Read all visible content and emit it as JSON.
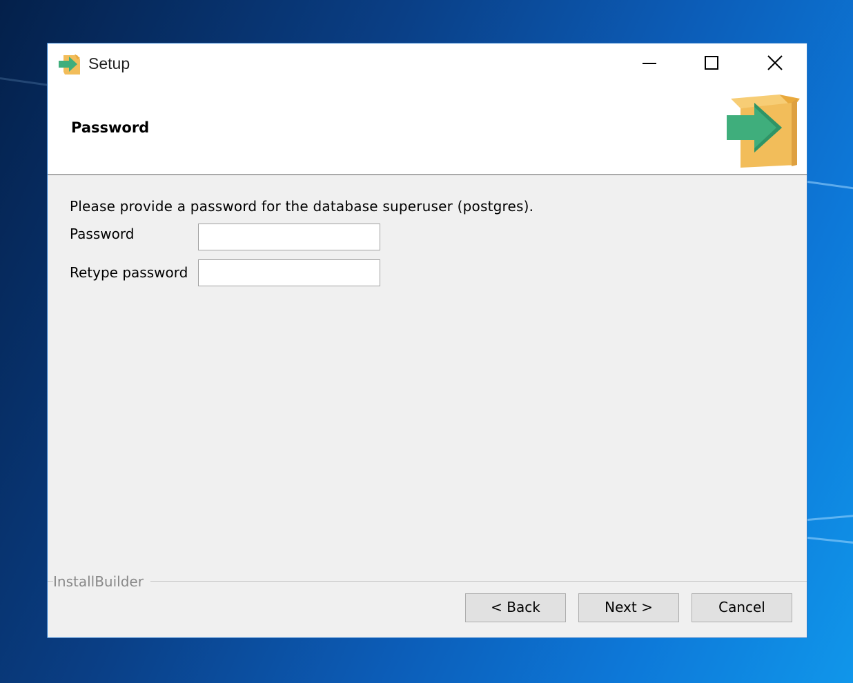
{
  "window": {
    "title": "Setup",
    "controls": [
      "minimize-icon",
      "maximize-icon",
      "close-icon"
    ]
  },
  "header": {
    "title": "Password",
    "logo_icon": "installer-box-arrow-icon"
  },
  "main": {
    "description": "Please provide a password for the database superuser (postgres).",
    "fields": [
      {
        "label": "Password",
        "value": "",
        "placeholder": ""
      },
      {
        "label": "Retype password",
        "value": "",
        "placeholder": ""
      }
    ]
  },
  "footer": {
    "brand": "InstallBuilder",
    "back_label": "< Back",
    "next_label": "Next >",
    "cancel_label": "Cancel"
  },
  "colors": {
    "window_border": "#2b78c9",
    "dialog_bg": "#f0f0f0",
    "button_bg": "#e1e1e1",
    "icon_arrow_green": "#3fae7c",
    "icon_box_orange": "#f2bd5a"
  }
}
